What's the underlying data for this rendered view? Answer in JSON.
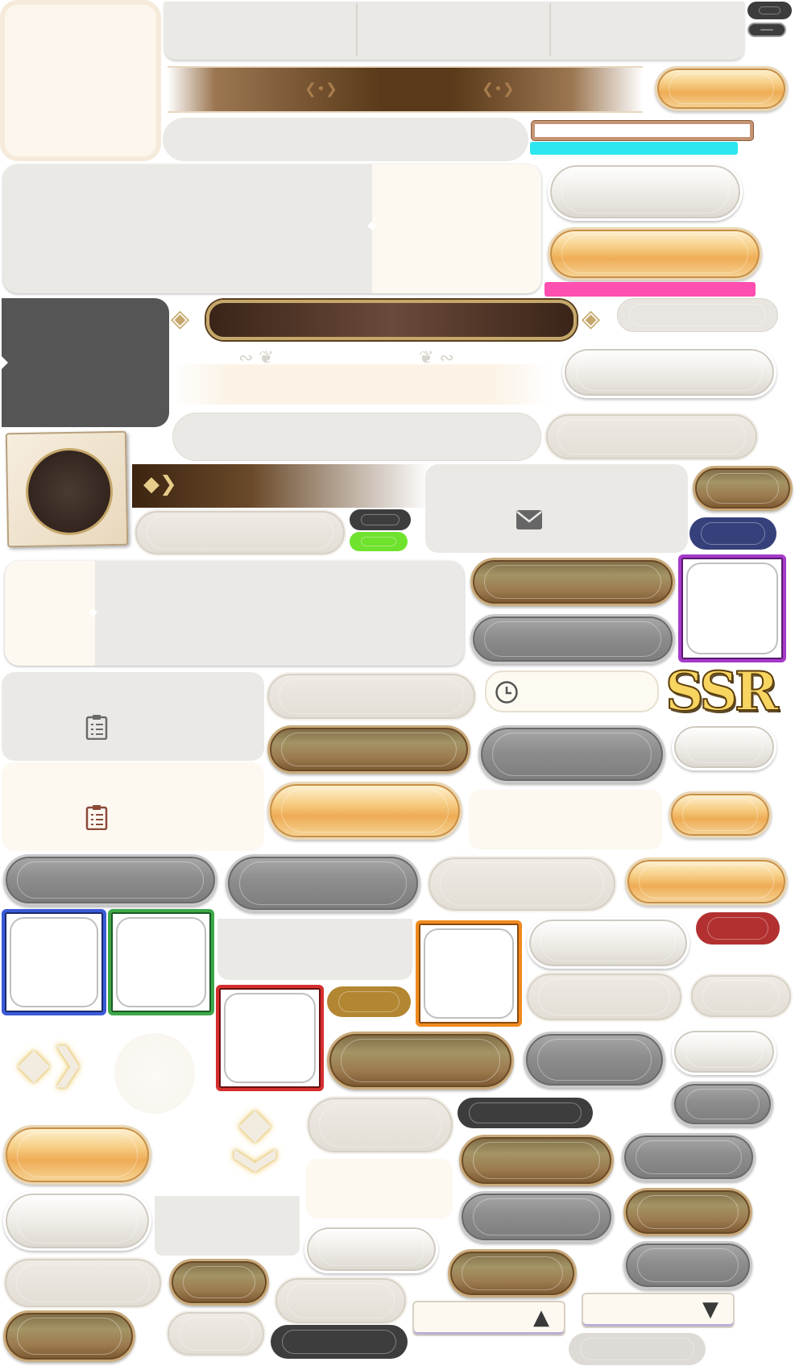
{
  "rarity_label": "SSR",
  "icons": {
    "mail": "mail-icon",
    "clock": "clock-icon",
    "clipboard": "clipboard-icon",
    "arrow_up": "triangle-up-icon",
    "arrow_down": "triangle-down-icon",
    "chevron": "double-chevron-icon"
  },
  "colors": {
    "gold": "#f2b866",
    "bronze": "#9b8553",
    "grey": "#8c8c8c",
    "cyan": "#2ee6ef",
    "pink": "#ff4fb0",
    "navy": "#36407a",
    "green": "#6fe22e",
    "red": "#b33030",
    "frame_blue": "#3a5bd6",
    "frame_green": "#3da84a",
    "frame_red": "#d62e2e",
    "frame_orange": "#f08a1e",
    "frame_purple": "#a63ac9"
  }
}
